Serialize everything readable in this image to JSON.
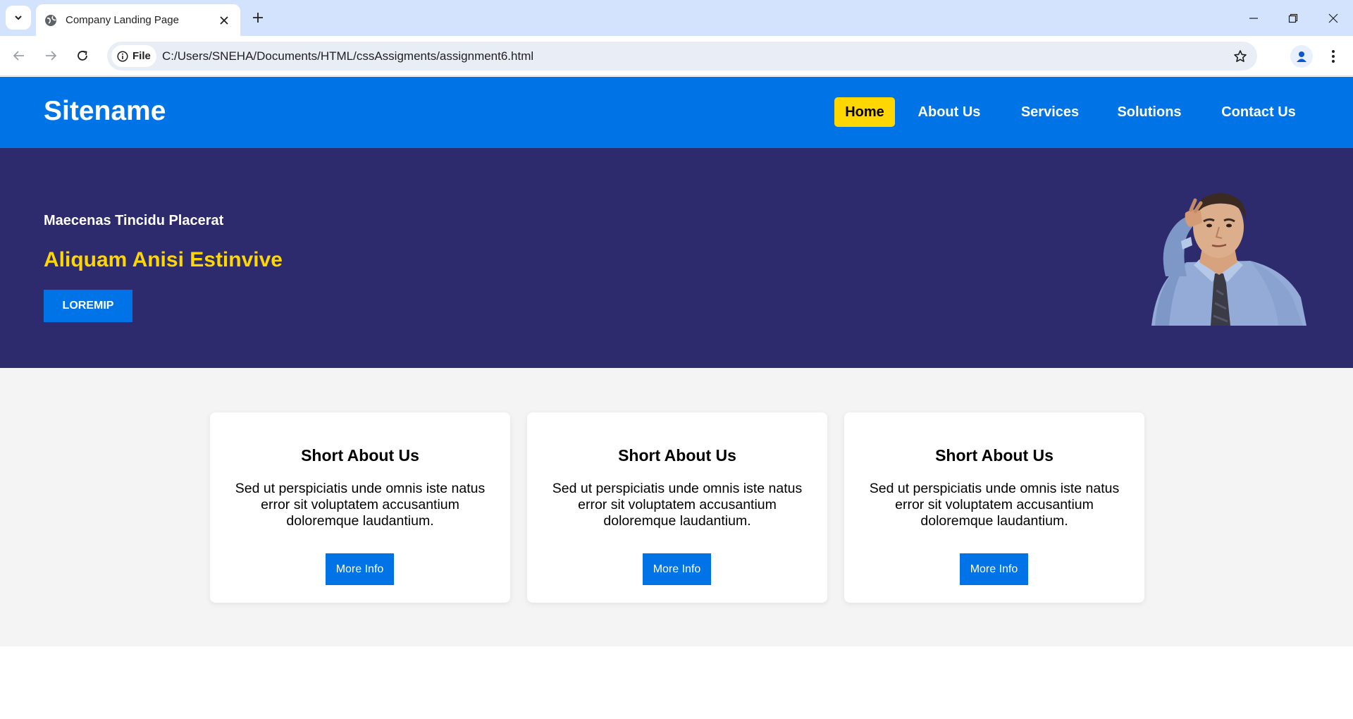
{
  "browser": {
    "tab_title": "Company Landing Page",
    "address_chip": "File",
    "url": "C:/Users/SNEHA/Documents/HTML/cssAssigments/assignment6.html",
    "icons": [
      "tab-search-icon",
      "globe-icon",
      "close-icon",
      "plus-icon",
      "minimize-icon",
      "restore-icon",
      "window-close-icon",
      "back-arrow-icon",
      "forward-arrow-icon",
      "reload-icon",
      "info-icon",
      "bookmark-star-icon",
      "profile-icon",
      "kebab-menu-icon"
    ]
  },
  "header": {
    "logo": "Sitename",
    "nav": [
      {
        "label": "Home",
        "active": true
      },
      {
        "label": "About Us",
        "active": false
      },
      {
        "label": "Services",
        "active": false
      },
      {
        "label": "Solutions",
        "active": false
      },
      {
        "label": "Contact Us",
        "active": false
      }
    ]
  },
  "hero": {
    "subtitle": "Maecenas Tincidu Placerat",
    "title": "Aliquam Anisi Estinvive",
    "button": "LOREMIP"
  },
  "cards": [
    {
      "title": "Short About Us",
      "text": "Sed ut perspiciatis unde omnis iste natus error sit voluptatem accusantium doloremque laudantium.",
      "button": "More Info"
    },
    {
      "title": "Short About Us",
      "text": "Sed ut perspiciatis unde omnis iste natus error sit voluptatem accusantium doloremque laudantium.",
      "button": "More Info"
    },
    {
      "title": "Short About Us",
      "text": "Sed ut perspiciatis unde omnis iste natus error sit voluptatem accusantium doloremque laudantium.",
      "button": "More Info"
    }
  ],
  "colors": {
    "header_bg": "#0073e6",
    "active_nav": "#ffd700",
    "hero_bg": "#2d2a6e",
    "hero_title": "#ffd700",
    "section_bg": "#f4f4f4"
  }
}
